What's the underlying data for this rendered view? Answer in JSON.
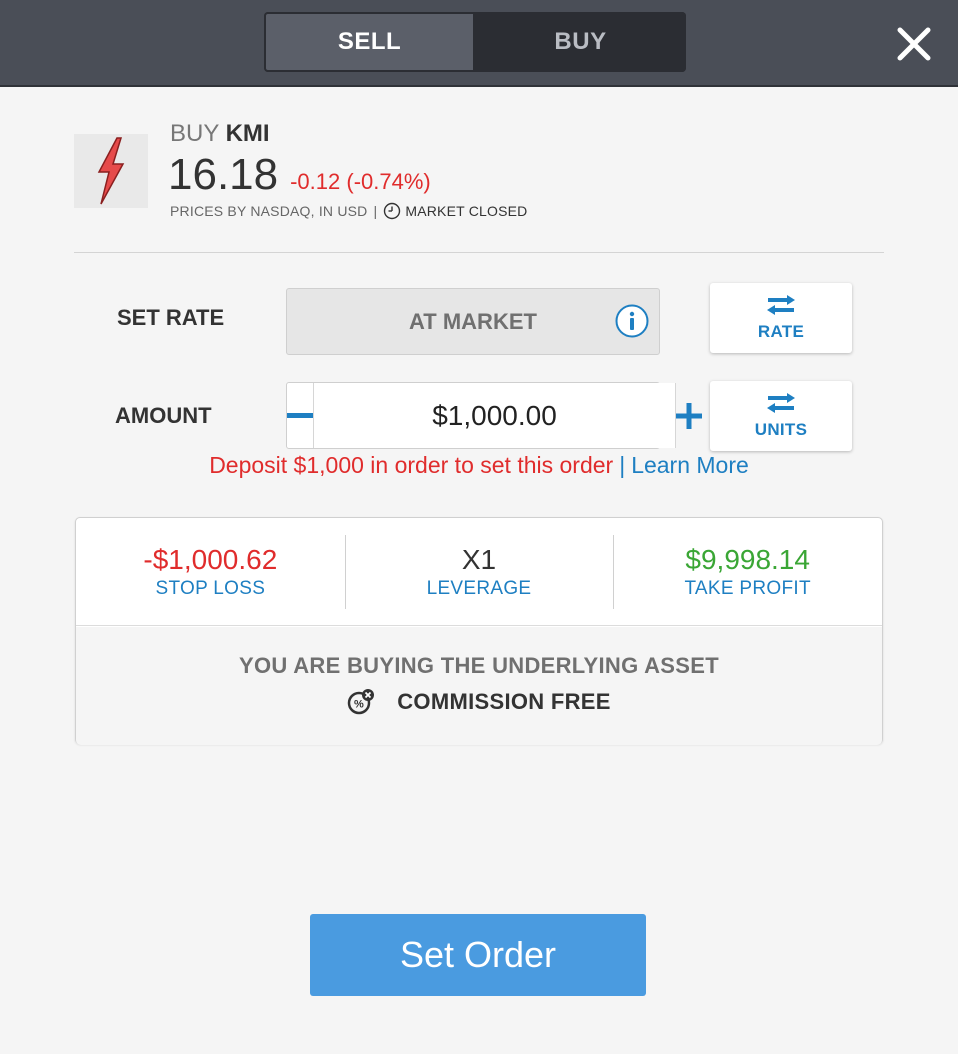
{
  "header": {
    "tabs": [
      {
        "label": "SELL",
        "active": true
      },
      {
        "label": "BUY",
        "active": false
      }
    ],
    "close_icon": "close-icon"
  },
  "asset": {
    "action": "BUY",
    "symbol": "KMI",
    "price": "16.18",
    "change": "-0.12 (-0.74%)",
    "price_source": "PRICES BY NASDAQ, IN USD",
    "separator": "|",
    "market_status": "MARKET CLOSED",
    "logo_icon": "lightning-bolt-logo"
  },
  "rate": {
    "label": "SET RATE",
    "value": "AT MARKET",
    "toggle_label": "RATE"
  },
  "amount": {
    "label": "AMOUNT",
    "value": "$1,000.00",
    "toggle_label": "UNITS"
  },
  "notice": {
    "text": "Deposit $1,000 in order to set this order",
    "separator": "|",
    "link": "Learn More"
  },
  "summary": {
    "stop_loss": {
      "value": "-$1,000.62",
      "label": "STOP LOSS"
    },
    "leverage": {
      "value": "X1",
      "label": "LEVERAGE"
    },
    "take_profit": {
      "value": "$9,998.14",
      "label": "TAKE PROFIT"
    },
    "underlying_text": "YOU ARE BUYING THE UNDERLYING ASSET",
    "commission_text": "COMMISSION FREE"
  },
  "submit": {
    "label": "Set Order"
  },
  "colors": {
    "accent": "#1e7fc2",
    "negative": "#e02c2c",
    "positive": "#3aa635",
    "button": "#4a9be0",
    "header": "#4a4e57"
  }
}
